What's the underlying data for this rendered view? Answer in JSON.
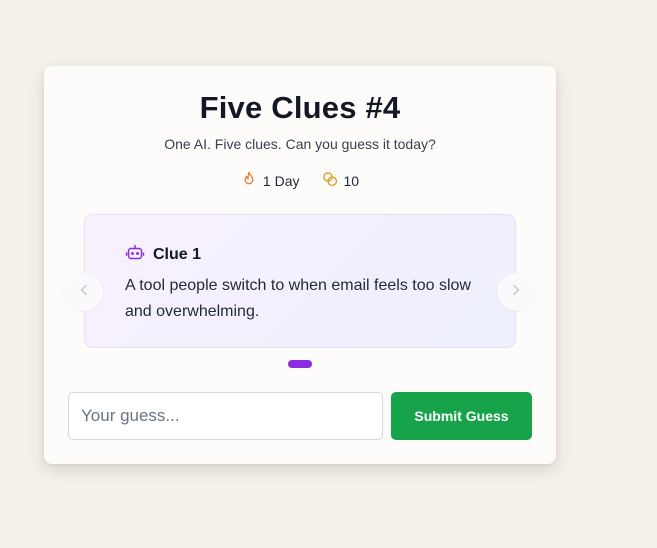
{
  "game": {
    "title": "Five Clues #4",
    "subtitle": "One AI. Five clues. Can you guess it today?",
    "streak_label": "1 Day",
    "coins_label": "10"
  },
  "clue": {
    "heading": "Clue 1",
    "text": "A tool people switch to when email feels too slow and overwhelming."
  },
  "carousel": {
    "current_index": 1,
    "visible_dot_count": 1
  },
  "guess": {
    "placeholder": "Your guess...",
    "value": "",
    "submit_label": "Submit Guess"
  },
  "icons": {
    "streak": "flame-icon",
    "coins": "coins-icon",
    "clue": "robot-icon",
    "prev": "chevron-left-icon",
    "next": "chevron-right-icon"
  },
  "colors": {
    "background": "#f5f0e9",
    "accent_purple": "#8b2be2",
    "submit_green": "#16a34a",
    "flame_orange": "#ea7a2a",
    "coin_gold": "#d99a1c"
  }
}
